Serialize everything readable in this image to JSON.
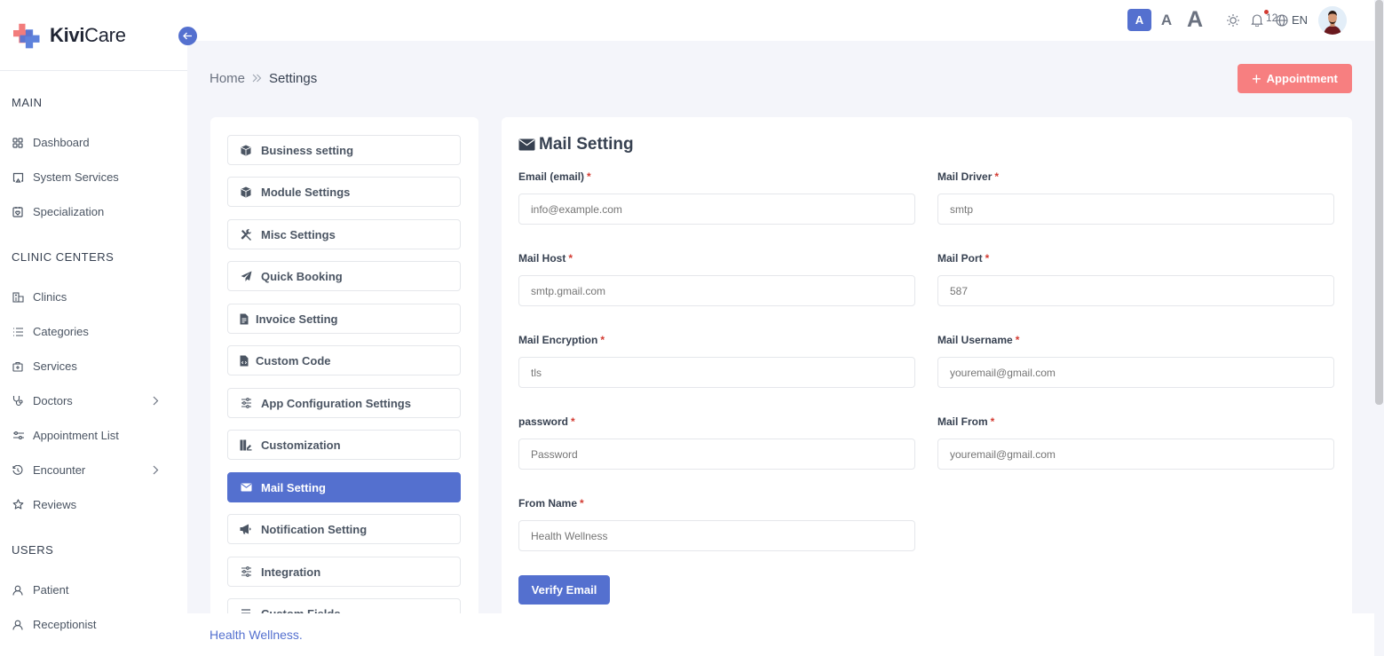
{
  "brand": {
    "name_bold": "Kivi",
    "name_rest": "Care"
  },
  "sidebar": {
    "sections": [
      {
        "title": "MAIN",
        "items": [
          {
            "label": "Dashboard",
            "icon": "dashboard-icon"
          },
          {
            "label": "System Services",
            "icon": "system-services-icon"
          },
          {
            "label": "Specialization",
            "icon": "specialization-icon"
          }
        ]
      },
      {
        "title": "CLINIC CENTERS",
        "items": [
          {
            "label": "Clinics",
            "icon": "clinic-icon"
          },
          {
            "label": "Categories",
            "icon": "list-icon"
          },
          {
            "label": "Services",
            "icon": "services-icon"
          },
          {
            "label": "Doctors",
            "icon": "stethoscope-icon",
            "has_submenu": true
          },
          {
            "label": "Appointment List",
            "icon": "sliders-icon"
          },
          {
            "label": "Encounter",
            "icon": "history-icon",
            "has_submenu": true
          },
          {
            "label": "Reviews",
            "icon": "star-icon"
          }
        ]
      },
      {
        "title": "USERS",
        "items": [
          {
            "label": "Patient",
            "icon": "user-icon"
          },
          {
            "label": "Receptionist",
            "icon": "user-icon"
          }
        ]
      }
    ]
  },
  "topbar": {
    "font_sizes": [
      "A",
      "A",
      "A"
    ],
    "notification_count": "12",
    "language": "EN"
  },
  "breadcrumb": {
    "home": "Home",
    "current": "Settings"
  },
  "appointment_button": {
    "label": "Appointment"
  },
  "settings_menu": {
    "items": [
      {
        "label": "Business setting",
        "icon": "cube-icon"
      },
      {
        "label": "Module Settings",
        "icon": "cube-icon"
      },
      {
        "label": "Misc Settings",
        "icon": "tools-icon"
      },
      {
        "label": "Quick Booking",
        "icon": "paper-plane-icon"
      },
      {
        "label": "Invoice Setting",
        "icon": "invoice-icon"
      },
      {
        "label": "Custom Code",
        "icon": "code-file-icon"
      },
      {
        "label": "App Configuration Settings",
        "icon": "sliders-icon"
      },
      {
        "label": "Customization",
        "icon": "palette-icon"
      },
      {
        "label": "Mail Setting",
        "icon": "envelope-icon",
        "active": true
      },
      {
        "label": "Notification Setting",
        "icon": "megaphone-icon"
      },
      {
        "label": "Integration",
        "icon": "sliders-icon"
      },
      {
        "label": "Custom Fields",
        "icon": "list-icon"
      }
    ]
  },
  "mail_form": {
    "title": "Mail Setting",
    "fields": [
      {
        "label": "Email (email)",
        "required": true,
        "value": "",
        "placeholder": "info@example.com"
      },
      {
        "label": "Mail Driver",
        "required": true,
        "value": "",
        "placeholder": "smtp"
      },
      {
        "label": "Mail Host",
        "required": true,
        "value": "",
        "placeholder": "smtp.gmail.com"
      },
      {
        "label": "Mail Port",
        "required": true,
        "value": "",
        "placeholder": "587"
      },
      {
        "label": "Mail Encryption",
        "required": true,
        "value": "",
        "placeholder": "tls"
      },
      {
        "label": "Mail Username",
        "required": true,
        "value": "",
        "placeholder": "youremail@gmail.com"
      },
      {
        "label": "password",
        "required": true,
        "value": "",
        "placeholder": "Password"
      },
      {
        "label": "Mail From",
        "required": true,
        "value": "",
        "placeholder": "youremail@gmail.com"
      },
      {
        "label": "From Name",
        "required": true,
        "value": "",
        "placeholder": "Health Wellness"
      }
    ],
    "required_marker": "*",
    "verify_button": "Verify Email"
  },
  "footer": {
    "text": "Health Wellness."
  },
  "colors": {
    "primary": "#5470cf",
    "accent": "#f77f80",
    "required": "#d33b32",
    "background": "#f4f5fa"
  }
}
